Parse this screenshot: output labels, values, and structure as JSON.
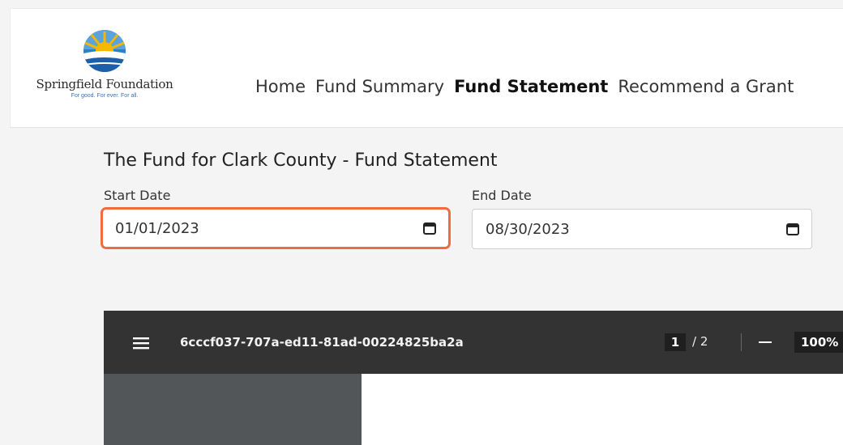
{
  "header": {
    "logo": {
      "name": "Springfield Foundation",
      "tagline": "For good. For ever. For all."
    },
    "nav": [
      {
        "label": "Home",
        "active": false
      },
      {
        "label": "Fund Summary",
        "active": false
      },
      {
        "label": "Fund Statement",
        "active": true
      },
      {
        "label": "Recommend a Grant",
        "active": false
      }
    ]
  },
  "main": {
    "title": "The Fund for Clark County - Fund Statement",
    "start_date": {
      "label": "Start Date",
      "value": "01/01/2023"
    },
    "end_date": {
      "label": "End Date",
      "value": "08/30/2023"
    }
  },
  "viewer": {
    "doc_id": "6cccf037-707a-ed11-81ad-00224825ba2a",
    "current_page": "1",
    "page_total": "/ 2",
    "zoom": "100%"
  },
  "colors": {
    "focus_border": "#ee6c3d",
    "toolbar_bg": "#333333",
    "thumbnail_bg": "#525659",
    "logo_blue": "#3a73b8"
  },
  "icons": [
    "sun-logo-icon",
    "calendar-icon",
    "hamburger-menu-icon",
    "zoom-out-icon"
  ]
}
